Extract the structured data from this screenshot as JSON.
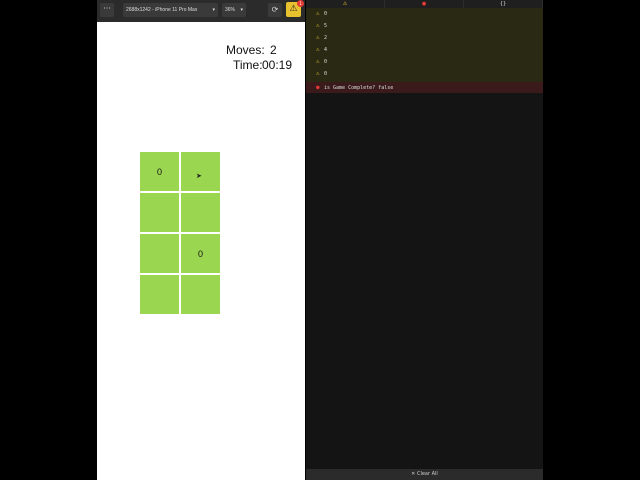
{
  "toolbar": {
    "menu_label": "···",
    "device": "2688x1242 - iPhone 11 Pro Max",
    "zoom": "36%",
    "reload_icon": "⟳",
    "warning_icon": "⚠",
    "warning_count": "1"
  },
  "game": {
    "moves_label": "Moves:",
    "moves_value": "2",
    "time_label": "Time:",
    "time_value": "00:19",
    "cells": [
      "0",
      "",
      "",
      "",
      "",
      "0",
      "",
      ""
    ],
    "cell_color": "#9bd651"
  },
  "console": {
    "tabs": [
      "⚠",
      "●",
      "{}"
    ],
    "logs": [
      "0",
      "5",
      "2",
      "4",
      "0",
      "0"
    ],
    "error": "is Game Complete? false",
    "footer": "✕ Clear All"
  }
}
